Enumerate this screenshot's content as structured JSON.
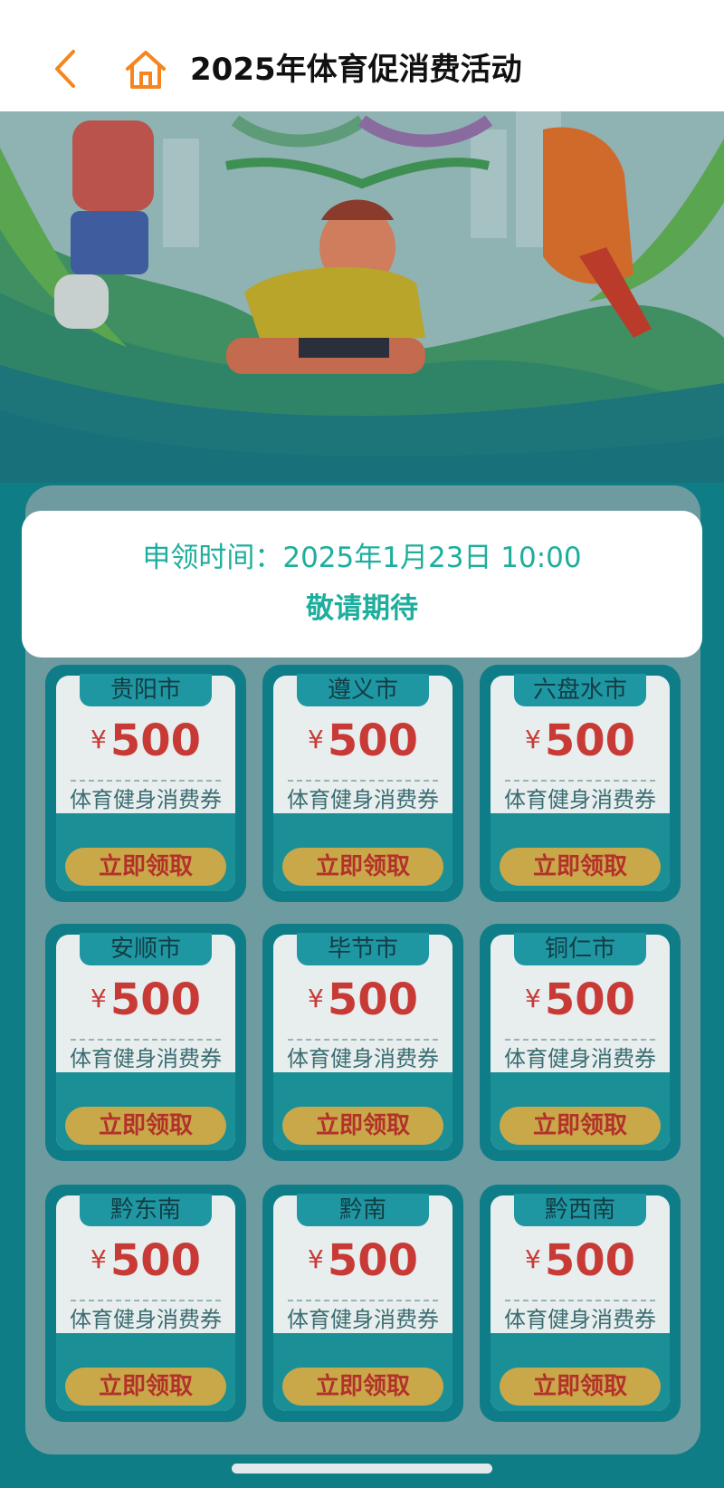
{
  "header": {
    "title": "2025年体育促消费活动",
    "back_icon": "chevron-left-icon",
    "home_icon": "home-icon",
    "accent_color": "#f5861f"
  },
  "notice": {
    "time_text": "申领时间：2025年1月23日 10:00",
    "subtitle": "敬请期待",
    "color": "#1fae9d"
  },
  "coupons": [
    {
      "city": "贵阳市",
      "currency": "¥",
      "amount": "500",
      "desc": "体育健身消费券",
      "button": "立即领取"
    },
    {
      "city": "遵义市",
      "currency": "¥",
      "amount": "500",
      "desc": "体育健身消费券",
      "button": "立即领取"
    },
    {
      "city": "六盘水市",
      "currency": "¥",
      "amount": "500",
      "desc": "体育健身消费券",
      "button": "立即领取"
    },
    {
      "city": "安顺市",
      "currency": "¥",
      "amount": "500",
      "desc": "体育健身消费券",
      "button": "立即领取"
    },
    {
      "city": "毕节市",
      "currency": "¥",
      "amount": "500",
      "desc": "体育健身消费券",
      "button": "立即领取"
    },
    {
      "city": "铜仁市",
      "currency": "¥",
      "amount": "500",
      "desc": "体育健身消费券",
      "button": "立即领取"
    },
    {
      "city": "黔东南",
      "currency": "¥",
      "amount": "500",
      "desc": "体育健身消费券",
      "button": "立即领取"
    },
    {
      "city": "黔南",
      "currency": "¥",
      "amount": "500",
      "desc": "体育健身消费券",
      "button": "立即领取"
    },
    {
      "city": "黔西南",
      "currency": "¥",
      "amount": "500",
      "desc": "体育健身消费券",
      "button": "立即领取"
    }
  ]
}
